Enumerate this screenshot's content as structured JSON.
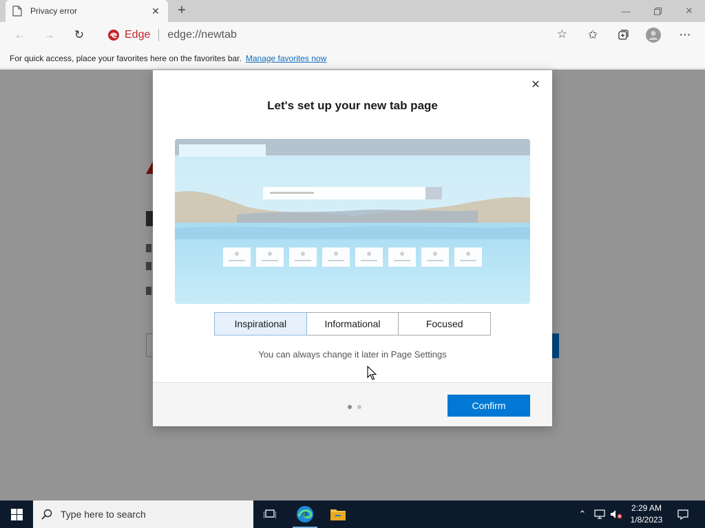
{
  "browser": {
    "tab": {
      "title": "Privacy error"
    },
    "address": {
      "brand": "Edge",
      "url": "edge://newtab"
    },
    "favorites_bar": {
      "message": "For quick access, place your favorites here on the favorites bar.",
      "link": "Manage favorites now"
    }
  },
  "dialog": {
    "title": "Let's set up your new tab page",
    "layouts": [
      {
        "label": "Inspirational",
        "selected": true
      },
      {
        "label": "Informational",
        "selected": false
      },
      {
        "label": "Focused",
        "selected": false
      }
    ],
    "hint": "You can always change it later in Page Settings",
    "step": {
      "current": 1,
      "total": 2
    },
    "confirm_label": "Confirm"
  },
  "taskbar": {
    "search_placeholder": "Type here to search",
    "clock": {
      "time": "2:29 AM",
      "date": "1/8/2023"
    }
  },
  "colors": {
    "accent": "#0078d4",
    "edge_brand": "#c4232b",
    "taskbar": "#0d1a2b",
    "link": "#0f6cbd"
  }
}
